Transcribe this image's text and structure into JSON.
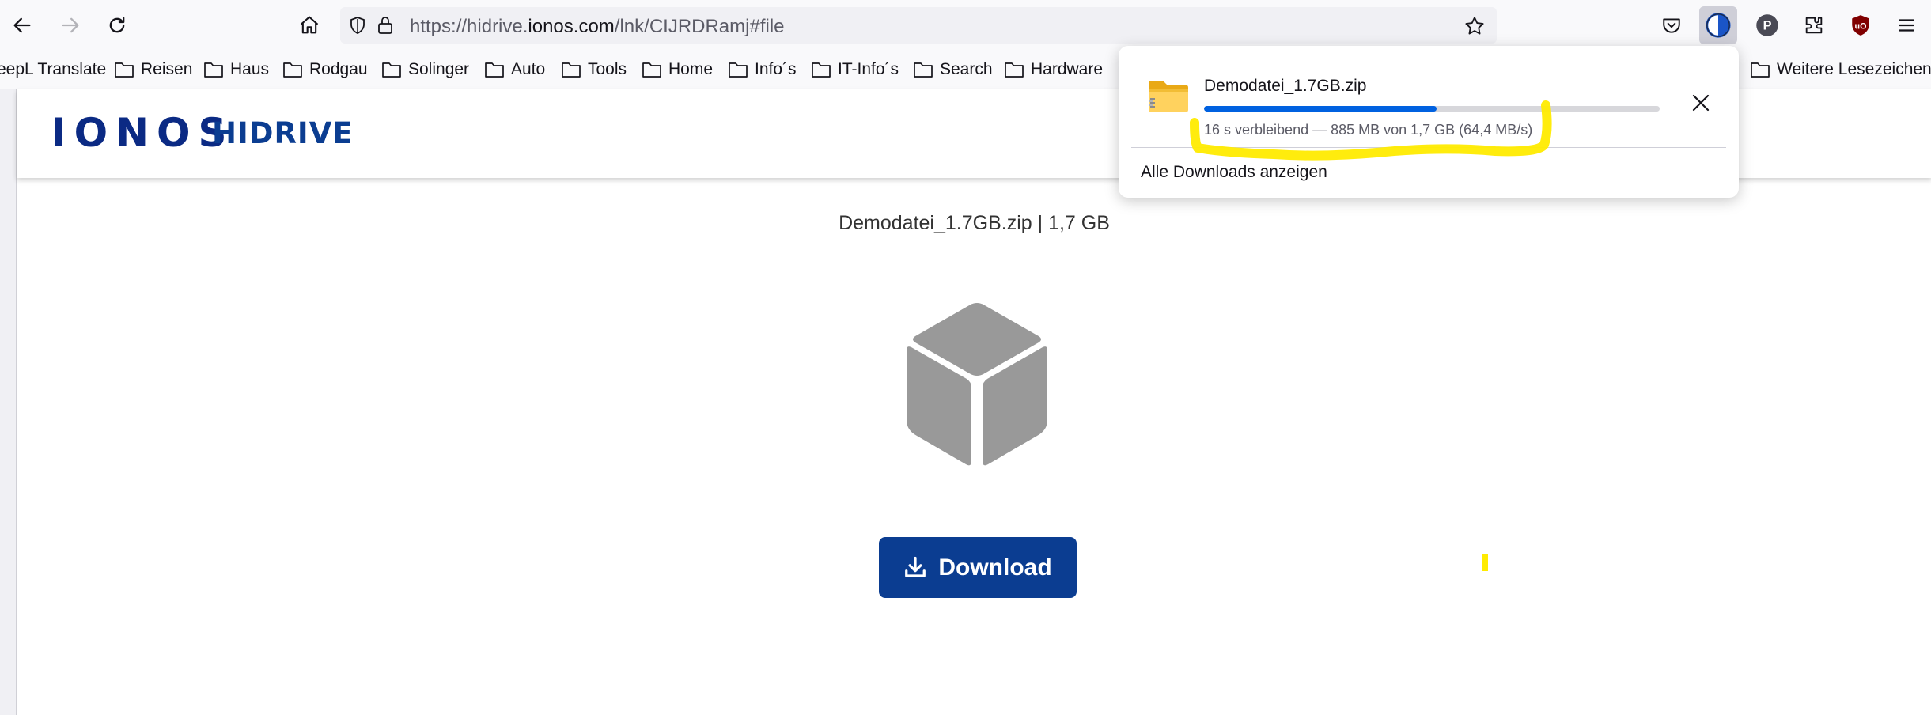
{
  "browser": {
    "url_prefix": "https://hidrive.",
    "url_host": "ionos.com",
    "url_suffix": "/lnk/CIJRDRamj#file",
    "bookmarks": [
      "eepL Translate",
      "Reisen",
      "Haus",
      "Rodgau",
      "Solinger",
      "Auto",
      "Tools",
      "Home",
      "Info´s",
      "IT-Info´s",
      "Search",
      "Hardware",
      "Weitere Lesezeichen"
    ]
  },
  "site": {
    "logo": "IONOS",
    "product": "HIDRIVE"
  },
  "file": {
    "name": "Demodatei_1.7GB.zip",
    "separator": "|",
    "size": "1,7 GB"
  },
  "download_button": {
    "label": "Download"
  },
  "downloads_panel": {
    "file_name": "Demodatei_1.7GB.zip",
    "progress_fraction": 0.51,
    "status": "16 s verbleibend — 885 MB von 1,7 GB (64,4 MB/s)",
    "show_all_label": "Alle Downloads anzeigen"
  },
  "colors": {
    "brand_blue": "#0b3d91",
    "progress_blue": "#0061e0",
    "highlight_yellow": "#ffeb00",
    "cube_gray": "#999999"
  },
  "icons": [
    "back-arrow-icon",
    "forward-arrow-icon",
    "reload-icon",
    "home-icon",
    "shield-icon",
    "lock-icon",
    "bookmark-star-icon",
    "pocket-icon",
    "dark-reader-icon",
    "profile-p-icon",
    "extensions-icon",
    "ublock-icon",
    "menu-icon",
    "folder-icon",
    "zip-folder-icon",
    "close-icon",
    "download-arrow-icon",
    "cube-icon"
  ]
}
